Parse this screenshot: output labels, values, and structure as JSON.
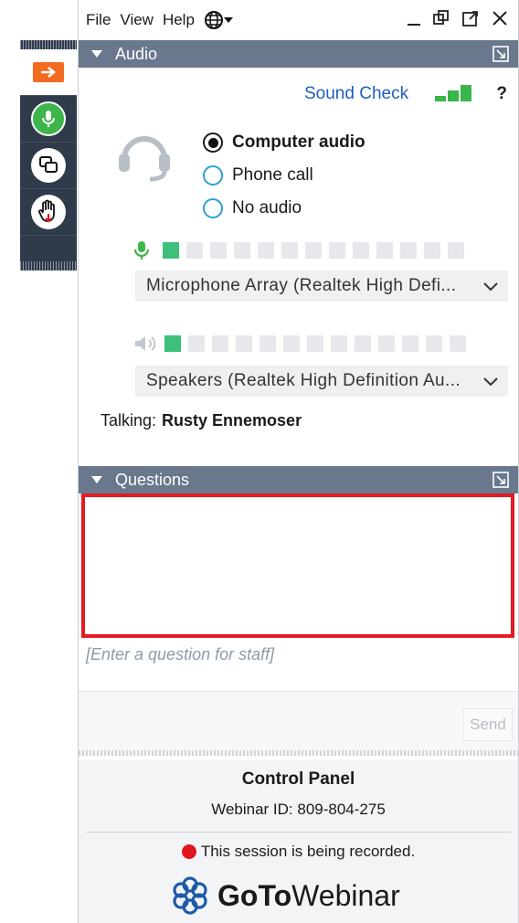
{
  "menu": {
    "file": "File",
    "view": "View",
    "help": "Help"
  },
  "audio": {
    "title": "Audio",
    "sound_check": "Sound Check",
    "help": "?",
    "options": [
      {
        "label": "Computer audio",
        "selected": true
      },
      {
        "label": "Phone call",
        "selected": false
      },
      {
        "label": "No audio",
        "selected": false
      }
    ],
    "mic_level": {
      "active": 1,
      "total": 13
    },
    "speaker_level": {
      "active": 1,
      "total": 13
    },
    "microphone": "Microphone Array (Realtek High Defi...",
    "speakers": "Speakers (Realtek High Definition Au...",
    "talking_label": "Talking:",
    "talking_name": "Rusty Ennemoser"
  },
  "questions": {
    "title": "Questions",
    "placeholder": "[Enter a question for staff]",
    "send": "Send"
  },
  "footer": {
    "title": "Control Panel",
    "webinar_id": "Webinar ID: 809-804-275",
    "recording": "This session is being recorded.",
    "brand_goto": "GoTo",
    "brand_webinar": "Webinar"
  },
  "colors": {
    "accent": "#1f5fbf",
    "section": "#69788c",
    "highlight": "#e31b23",
    "orange": "#f26b21",
    "green": "#3cb54a"
  }
}
